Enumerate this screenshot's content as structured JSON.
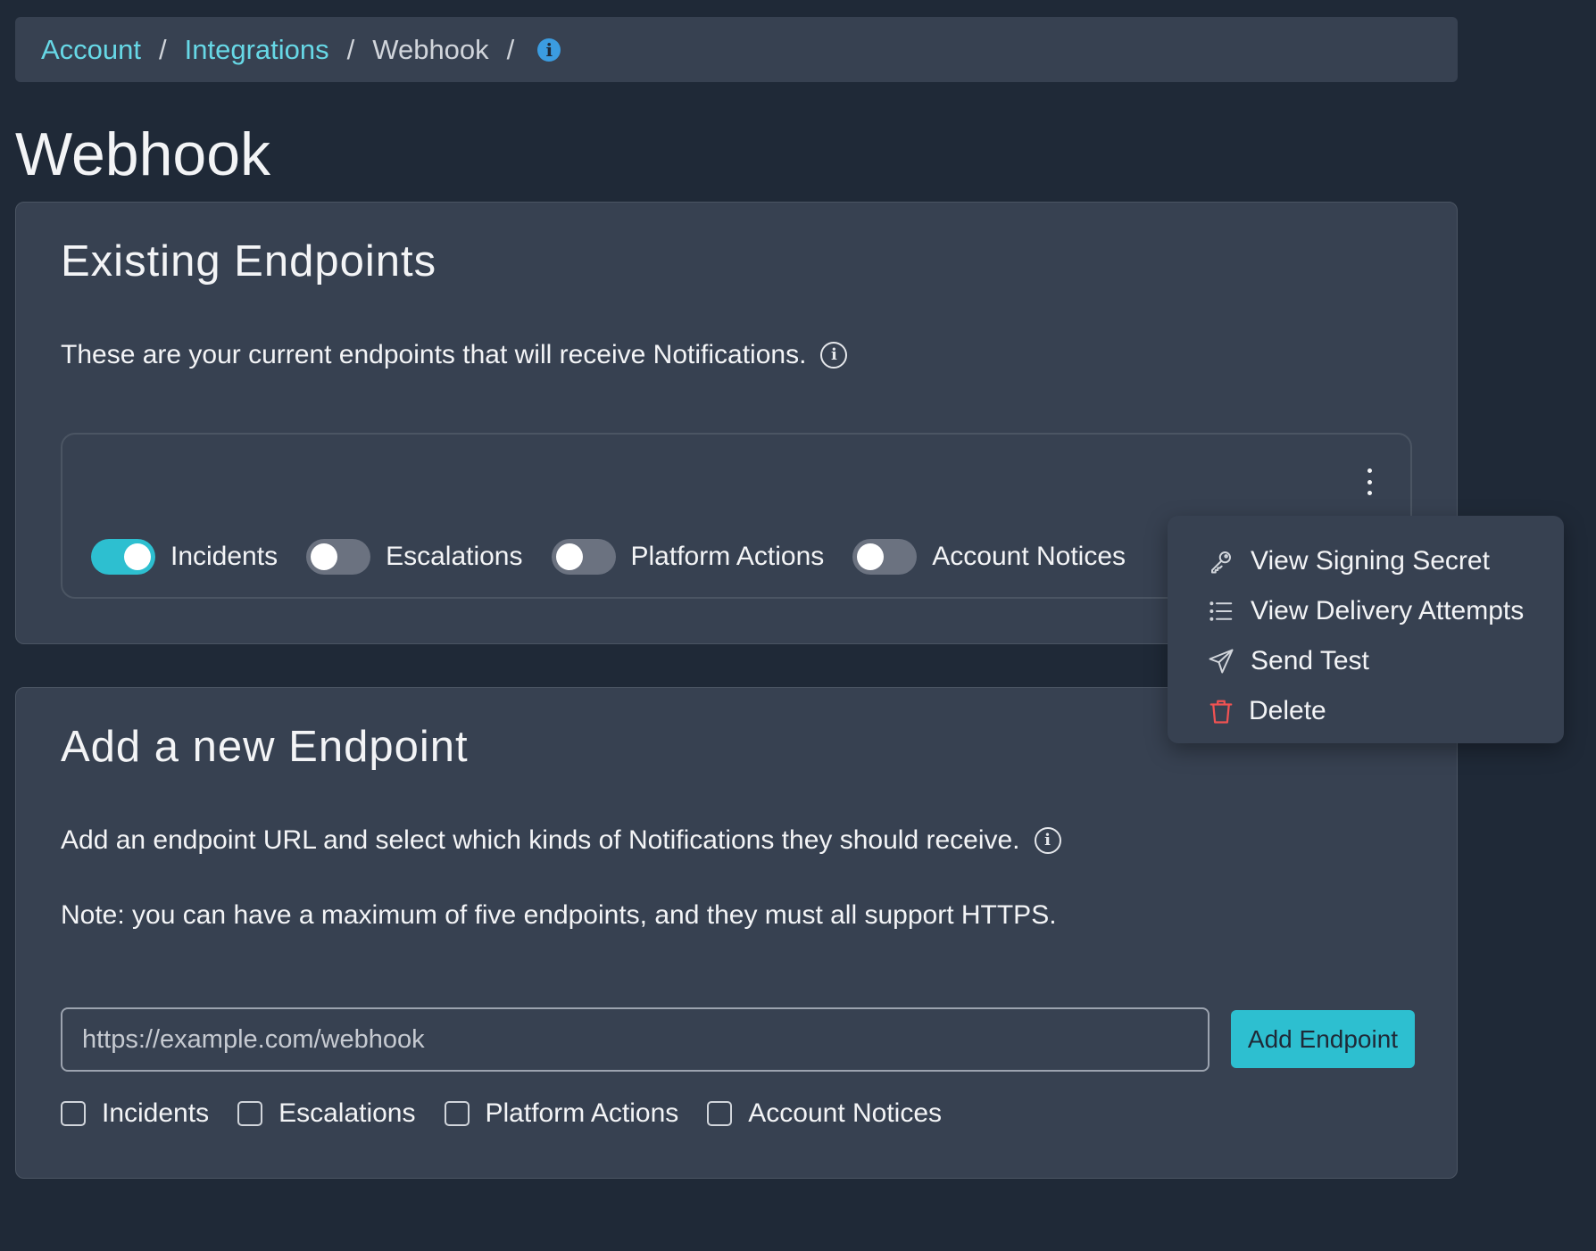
{
  "breadcrumb": {
    "items": [
      "Account",
      "Integrations",
      "Webhook"
    ],
    "separator": "/"
  },
  "page": {
    "title": "Webhook"
  },
  "existing": {
    "title": "Existing Endpoints",
    "description": "These are your current endpoints that will receive Notifications.",
    "toggles": [
      {
        "label": "Incidents",
        "on": true
      },
      {
        "label": "Escalations",
        "on": false
      },
      {
        "label": "Platform Actions",
        "on": false
      },
      {
        "label": "Account Notices",
        "on": false
      }
    ]
  },
  "menu": {
    "items": [
      {
        "label": "View Signing Secret",
        "icon": "key-icon"
      },
      {
        "label": "View Delivery Attempts",
        "icon": "list-icon"
      },
      {
        "label": "Send Test",
        "icon": "send-icon"
      },
      {
        "label": "Delete",
        "icon": "trash-icon"
      }
    ]
  },
  "add": {
    "title": "Add a new Endpoint",
    "description": "Add an endpoint URL and select which kinds of Notifications they should receive.",
    "note": "Note: you can have a maximum of five endpoints, and they must all support HTTPS.",
    "url_placeholder": "https://example.com/webhook",
    "button_label": "Add Endpoint",
    "checkboxes": [
      {
        "label": "Incidents",
        "checked": false
      },
      {
        "label": "Escalations",
        "checked": false
      },
      {
        "label": "Platform Actions",
        "checked": false
      },
      {
        "label": "Account Notices",
        "checked": false
      }
    ]
  },
  "colors": {
    "background": "#1f2937",
    "panel": "#374151",
    "accent": "#2dbfd0",
    "link": "#67d8e6",
    "danger": "#f05252",
    "info_icon": "#3b9ce0"
  }
}
